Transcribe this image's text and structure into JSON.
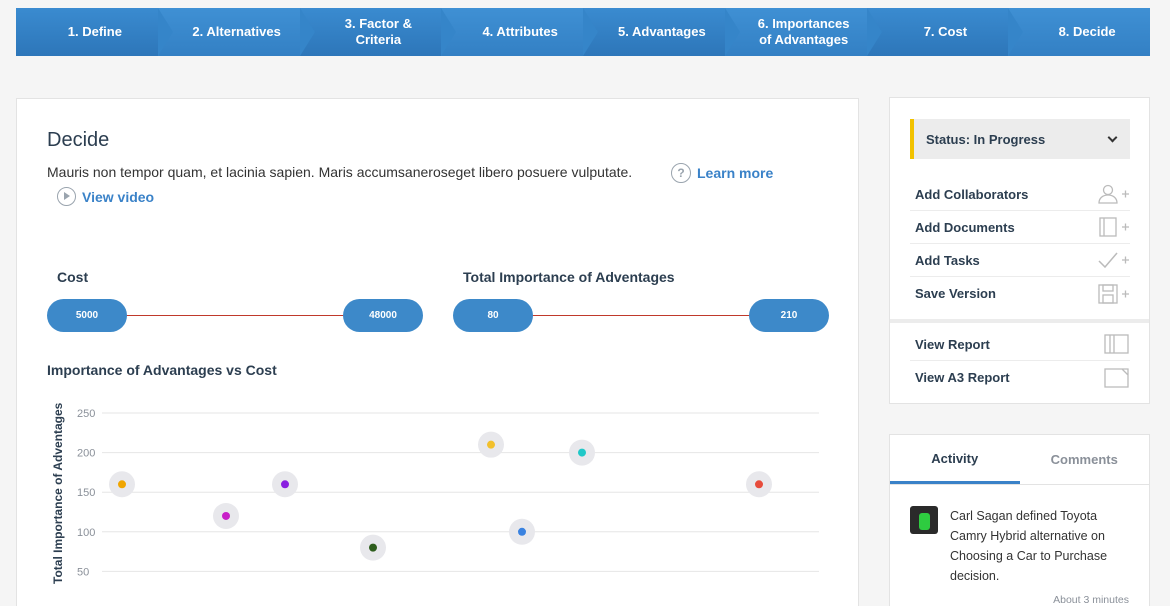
{
  "stepper": {
    "steps": [
      "1. Define",
      "2. Alternatives",
      "3. Factor & Criteria",
      "4. Attributes",
      "5. Advantages",
      "6. Importances of Advantages",
      "7. Cost",
      "8. Decide"
    ]
  },
  "main": {
    "title": "Decide",
    "description": "Mauris non tempor quam, et lacinia sapien. Maris accumsaneroseget libero posuere vulputate.",
    "learn_more": "Learn more",
    "help_icon_glyph": "?",
    "view_video": "View video",
    "cost_range": {
      "label": "Cost",
      "min": "5000",
      "max": "48000"
    },
    "importance_range": {
      "label": "Total Importance of Adventages",
      "min": "80",
      "max": "210"
    },
    "chart_title": "Importance of Advantages vs Cost"
  },
  "chart_data": {
    "type": "scatter",
    "title": "Importance of Advantages vs Cost",
    "xlabel": "",
    "ylabel": "Total Importance of Adventages",
    "ylim": [
      0,
      250
    ],
    "yticks": [
      "250",
      "200",
      "150",
      "100",
      "50"
    ],
    "grid": true,
    "points": [
      {
        "x": 1,
        "y": 160,
        "color": "#f0a500"
      },
      {
        "x": 2,
        "y": 120,
        "color": "#c81fc8"
      },
      {
        "x": 3,
        "y": 160,
        "color": "#8a1fe0"
      },
      {
        "x": 4,
        "y": 80,
        "color": "#2e5e1e"
      },
      {
        "x": 5,
        "y": 210,
        "color": "#f2c02c"
      },
      {
        "x": 6,
        "y": 100,
        "color": "#3a82e0"
      },
      {
        "x": 7,
        "y": 200,
        "color": "#20c8c8"
      },
      {
        "x": 8,
        "y": 160,
        "color": "#e74c3c"
      }
    ]
  },
  "sidebar": {
    "status": "Status: In Progress",
    "actions": [
      {
        "label": "Add Collaborators",
        "icon": "add-user-icon"
      },
      {
        "label": "Add Documents",
        "icon": "add-document-icon"
      },
      {
        "label": "Add Tasks",
        "icon": "add-task-icon"
      },
      {
        "label": "Save Version",
        "icon": "save-icon"
      }
    ],
    "reports": [
      {
        "label": "View Report",
        "icon": "report-icon"
      },
      {
        "label": "View A3 Report",
        "icon": "a3-report-icon"
      }
    ]
  },
  "activity": {
    "tabs": [
      "Activity",
      "Comments"
    ],
    "item_text": "Carl Sagan defined Toyota Camry Hybrid alternative on Choosing a Car to Purchase decision.",
    "item_time": "About 3 minutes"
  },
  "colors": {
    "accent": "#3a82c8",
    "stepper": "#2e7ac0",
    "status_bar": "#f2c200",
    "range_line": "#c0392b"
  }
}
